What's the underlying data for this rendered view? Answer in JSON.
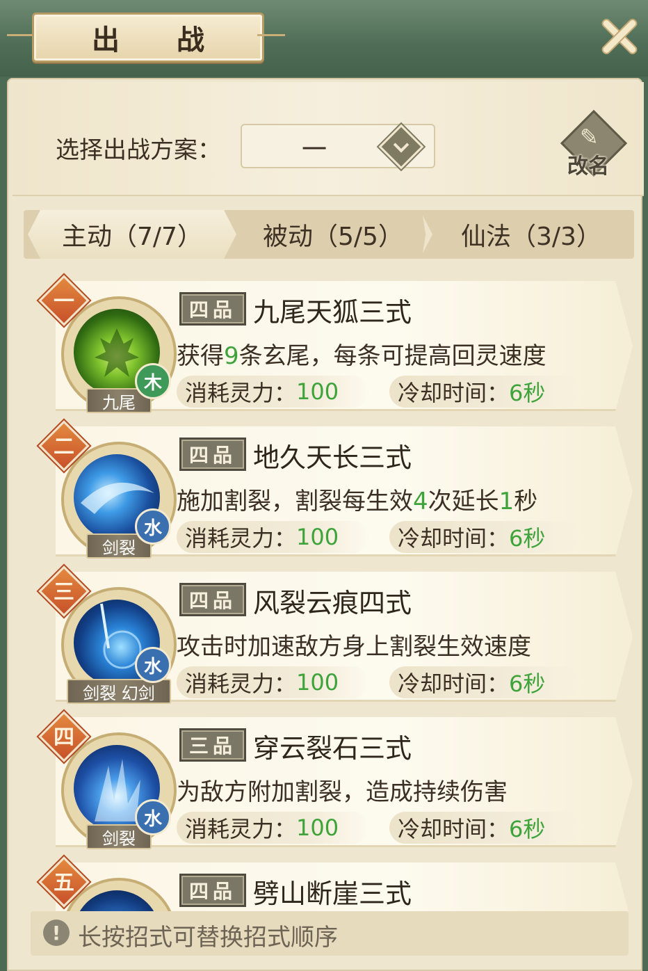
{
  "title": "出 战",
  "close_icon": "close-x-icon",
  "scheme": {
    "label": "选择出战方案：",
    "value": "一",
    "rename_label": "改名"
  },
  "tabs": [
    {
      "label": "主动（7/7）",
      "active": true
    },
    {
      "label": "被动（5/5）",
      "active": false
    },
    {
      "label": "仙法（3/3）",
      "active": false
    }
  ],
  "skills": [
    {
      "index": "一",
      "grade": "四品",
      "name": "九尾天狐三式",
      "desc_pre": "获得",
      "desc_num": "9",
      "desc_mid": "条玄尾，每条可提高回灵速度",
      "desc_num2": "",
      "desc_post": "",
      "tag": "九尾",
      "element": "木",
      "element_color": "#3f9a5a",
      "cost_label": "消耗灵力：",
      "cost": "100",
      "cd_label": "冷却时间：",
      "cd": "6秒"
    },
    {
      "index": "二",
      "grade": "四品",
      "name": "地久天长三式",
      "desc_pre": "施加割裂，割裂每生效",
      "desc_num": "4",
      "desc_mid": "次延长",
      "desc_num2": "1",
      "desc_post": "秒",
      "tag": "剑裂",
      "element": "水",
      "element_color": "#3a6fb0",
      "cost_label": "消耗灵力：",
      "cost": "100",
      "cd_label": "冷却时间：",
      "cd": "6秒"
    },
    {
      "index": "三",
      "grade": "四品",
      "name": "风裂云痕四式",
      "desc_pre": "攻击时加速敌方身上割裂生效速度",
      "desc_num": "",
      "desc_mid": "",
      "desc_num2": "",
      "desc_post": "",
      "tag": "剑裂 幻剑",
      "element": "水",
      "element_color": "#3a6fb0",
      "cost_label": "消耗灵力：",
      "cost": "100",
      "cd_label": "冷却时间：",
      "cd": "6秒"
    },
    {
      "index": "四",
      "grade": "三品",
      "name": "穿云裂石三式",
      "desc_pre": "为敌方附加割裂，造成持续伤害",
      "desc_num": "",
      "desc_mid": "",
      "desc_num2": "",
      "desc_post": "",
      "tag": "剑裂",
      "element": "水",
      "element_color": "#3a6fb0",
      "cost_label": "消耗灵力：",
      "cost": "100",
      "cd_label": "冷却时间：",
      "cd": "6秒"
    },
    {
      "index": "五",
      "grade": "四品",
      "name": "劈山断崖三式"
    }
  ],
  "hint": {
    "icon": "exclamation-icon",
    "text": "长按招式可替换招式顺序"
  },
  "colors": {
    "accent_green": "#3ea33a",
    "number_badge": "#d0602f",
    "panel_bg": "#efe6cf"
  }
}
